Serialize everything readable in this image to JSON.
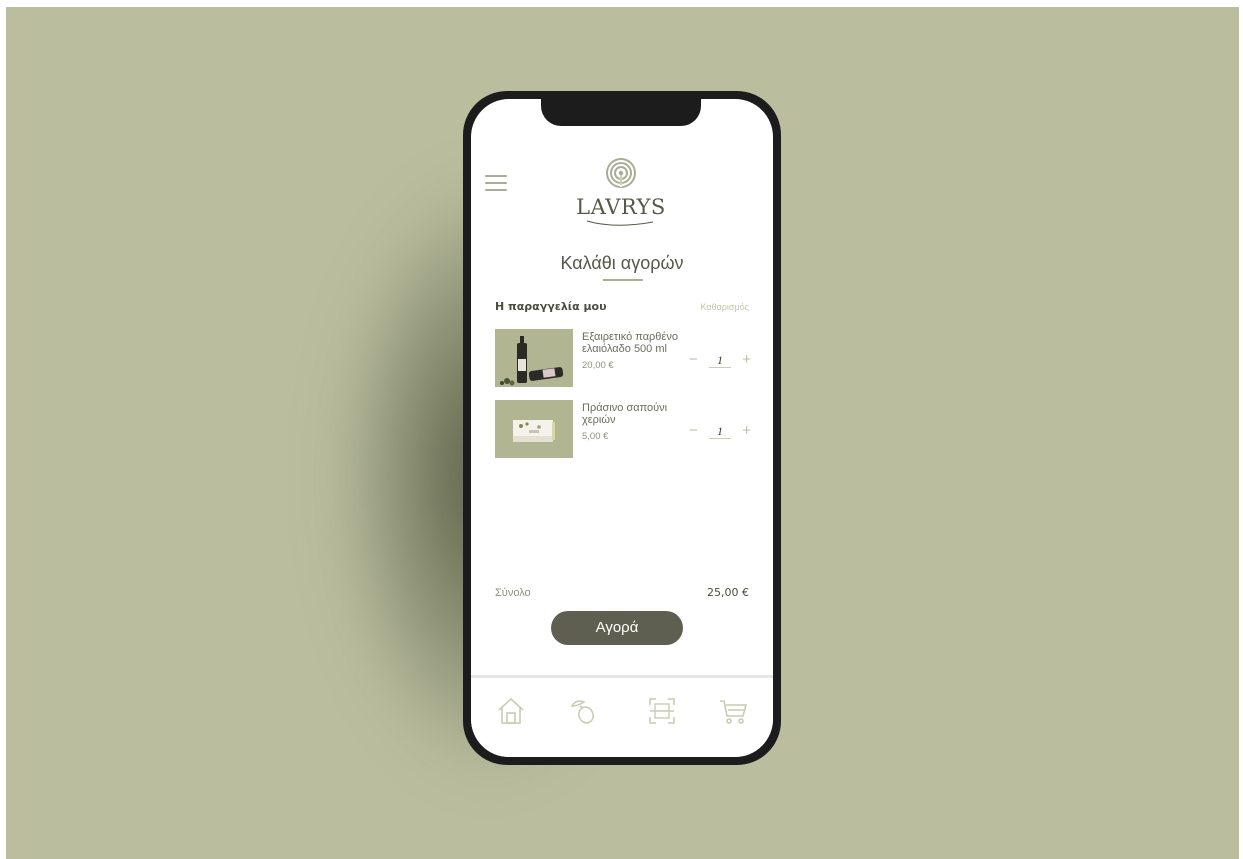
{
  "brand": {
    "name": "LAVRYS",
    "logo_icon": "labyrinth-icon",
    "accent_color": "#a9ad94"
  },
  "header": {
    "menu_icon": "hamburger-menu-icon"
  },
  "page": {
    "title": "Καλάθι αγορών"
  },
  "order": {
    "heading": "Η παραγγελία μου",
    "clear_label": "Καθαρισμός",
    "items": [
      {
        "name": "Εξαιρετικό παρθένο ελαιόλαδο 500 ml",
        "price": "20,00 €",
        "quantity": "1",
        "image": "olive-oil-bottles-photo"
      },
      {
        "name": "Πράσινο σαπούνι χεριών",
        "price": "5,00 €",
        "quantity": "1",
        "image": "hand-soap-box-photo"
      }
    ]
  },
  "summary": {
    "total_label": "Σύνολο",
    "total_value": "25,00 €"
  },
  "buy_button": {
    "label": "Αγορά",
    "color": "#5f5f51"
  },
  "tabbar": {
    "tabs": [
      "home-icon",
      "olive-icon",
      "scan-icon",
      "cart-icon"
    ]
  },
  "background_color": "#babe9e"
}
